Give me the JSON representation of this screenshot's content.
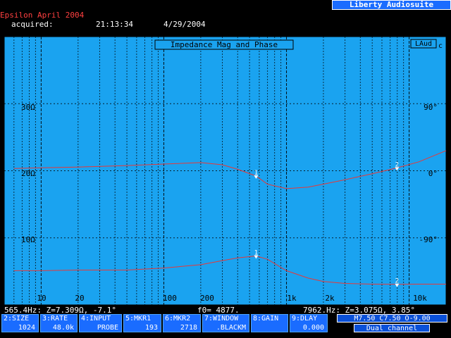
{
  "header": {
    "title": "Epsilon April 2004",
    "acquired_label": "acquired:",
    "time": "21:13:34",
    "date": "4/29/2004",
    "brand": "Liberty Audiosuite"
  },
  "plot": {
    "title": "Impedance Mag and Phase",
    "badge": "LAud",
    "badge_suffix": "c",
    "colors": {
      "background": "#1aa3f0",
      "grid": "#000000",
      "trace": "#e83838"
    },
    "left_ticks": [
      "30Ω",
      "20Ω",
      "10Ω"
    ],
    "right_ticks": [
      "90°",
      "0°",
      "-90°"
    ],
    "x_ticks": [
      "10",
      "20",
      "100",
      "200",
      "1k",
      "2k",
      "10k"
    ],
    "marker1_label": "1",
    "marker2_label": "2"
  },
  "chart_data": {
    "type": "line",
    "title": "Impedance Mag and Phase",
    "x_scale": "log",
    "xlim": [
      5,
      20000
    ],
    "left_axis": {
      "unit": "ohm",
      "ylim": [
        0,
        40
      ],
      "ticks": [
        10,
        20,
        30
      ]
    },
    "right_axis": {
      "unit": "deg",
      "ylim": [
        -180,
        180
      ],
      "ticks": [
        -90,
        0,
        90
      ]
    },
    "series": [
      {
        "name": "",
        "axis": "left",
        "x": [
          6,
          10,
          20,
          50,
          100,
          200,
          300,
          400,
          565.4,
          700,
          1000,
          1500,
          2000,
          3000,
          5000,
          7962,
          12000,
          20000
        ],
        "y": [
          5.1,
          5.1,
          5.2,
          5.2,
          5.5,
          6.0,
          6.6,
          7.0,
          7.3,
          6.8,
          5.1,
          4.0,
          3.5,
          3.2,
          3.1,
          3.075,
          3.1,
          3.1
        ]
      },
      {
        "name": "",
        "axis": "right",
        "x": [
          6,
          10,
          20,
          50,
          100,
          200,
          300,
          400,
          565.4,
          700,
          1000,
          1500,
          2000,
          3000,
          5000,
          7962,
          12000,
          20000
        ],
        "y": [
          3,
          4,
          5,
          7,
          9,
          11,
          8,
          2,
          -7.1,
          -18,
          -24,
          -22,
          -18,
          -12,
          -4,
          3.85,
          12,
          27
        ]
      }
    ],
    "markers": [
      {
        "label": "1",
        "x": 565.4
      },
      {
        "label": "2",
        "x": 7962
      }
    ]
  },
  "readout": {
    "marker1": "565.4Hz: Z=7.309Ω, -7.1°",
    "f0": "f0= 4877.",
    "marker2": "7962.Hz: Z=3.075Ω, 3.85°"
  },
  "fkeys": [
    {
      "label": "2:SIZE",
      "value": "1024"
    },
    {
      "label": "3:RATE",
      "value": "48.0k"
    },
    {
      "label": "4:INPUT",
      "value": "PROBE"
    },
    {
      "label": "5:MKR1",
      "value": "193"
    },
    {
      "label": "6:MKR2",
      "value": "2718"
    },
    {
      "label": "7:WINDOW",
      "value": ".BLACKM"
    },
    {
      "label": "8:GAIN",
      "value": ""
    },
    {
      "label": "9:DLAY",
      "value": "0.000"
    }
  ],
  "status": {
    "levels": "M7.50 C7.50 O-9.00",
    "channel": "Dual channel"
  }
}
